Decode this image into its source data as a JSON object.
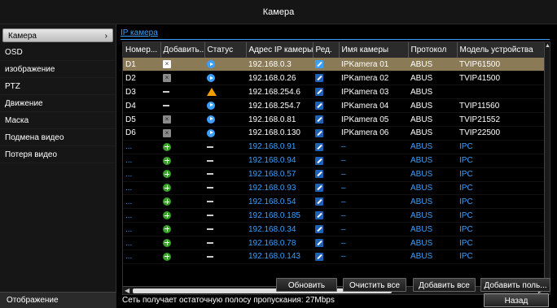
{
  "window": {
    "title": "Камера"
  },
  "sidebar": {
    "items": [
      {
        "label": "Камера",
        "active": true
      },
      {
        "label": "OSD"
      },
      {
        "label": "изображение"
      },
      {
        "label": "PTZ"
      },
      {
        "label": "Движение"
      },
      {
        "label": "Маска"
      },
      {
        "label": "Подмена видео"
      },
      {
        "label": "Потеря видео"
      }
    ],
    "bottom_label": "Отображение"
  },
  "tabs": [
    {
      "label": "IP камера",
      "active": true
    }
  ],
  "table": {
    "columns": [
      "Номер...",
      "Добавить...",
      "Статус",
      "Адрес IP камеры",
      "Ред.",
      "Имя камеры",
      "Протокол",
      "Модель устройства"
    ],
    "rows": [
      {
        "num": "D1",
        "add": "delete-icon",
        "status": "play-icon",
        "ip": "192.168.0.3",
        "edit": "edit-icon",
        "name": "IPKamera 01",
        "protocol": "ABUS",
        "model": "TVIP61500",
        "selected": true
      },
      {
        "num": "D2",
        "add": "delete-icon",
        "status": "play-icon",
        "ip": "192.168.0.26",
        "edit": "edit-icon",
        "name": "IPKamera 02",
        "protocol": "ABUS",
        "model": "TVIP41500"
      },
      {
        "num": "D3",
        "add": "dash",
        "status": "warning-icon",
        "ip": "192.168.254.6",
        "edit": "edit-icon",
        "name": "IPKamera 03",
        "protocol": "ABUS",
        "model": ""
      },
      {
        "num": "D4",
        "add": "dash",
        "status": "play-icon",
        "ip": "192.168.254.7",
        "edit": "edit-icon",
        "name": "IPKamera 04",
        "protocol": "ABUS",
        "model": "TVIP11560"
      },
      {
        "num": "D5",
        "add": "delete-icon",
        "status": "play-icon",
        "ip": "192.168.0.81",
        "edit": "edit-icon",
        "name": "IPKamera 05",
        "protocol": "ABUS",
        "model": "TVIP21552"
      },
      {
        "num": "D6",
        "add": "delete-icon",
        "status": "play-icon",
        "ip": "192.168.0.130",
        "edit": "edit-icon",
        "name": "IPKamera 06",
        "protocol": "ABUS",
        "model": "TVIP22500"
      },
      {
        "num": "...",
        "add": "add-icon",
        "status": "dash",
        "ip": "192.168.0.91",
        "edit": "edit-icon",
        "name": "–",
        "protocol": "ABUS",
        "model": "IPC",
        "found": true
      },
      {
        "num": "...",
        "add": "add-icon",
        "status": "dash",
        "ip": "192.168.0.94",
        "edit": "edit-icon",
        "name": "–",
        "protocol": "ABUS",
        "model": "IPC",
        "found": true
      },
      {
        "num": "...",
        "add": "add-icon",
        "status": "dash",
        "ip": "192.168.0.57",
        "edit": "edit-icon",
        "name": "–",
        "protocol": "ABUS",
        "model": "IPC",
        "found": true
      },
      {
        "num": "...",
        "add": "add-icon",
        "status": "dash",
        "ip": "192.168.0.93",
        "edit": "edit-icon",
        "name": "–",
        "protocol": "ABUS",
        "model": "IPC",
        "found": true
      },
      {
        "num": "...",
        "add": "add-icon",
        "status": "dash",
        "ip": "192.168.0.54",
        "edit": "edit-icon",
        "name": "–",
        "protocol": "ABUS",
        "model": "IPC",
        "found": true
      },
      {
        "num": "...",
        "add": "add-icon",
        "status": "dash",
        "ip": "192.168.0.185",
        "edit": "edit-icon",
        "name": "–",
        "protocol": "ABUS",
        "model": "IPC",
        "found": true
      },
      {
        "num": "...",
        "add": "add-icon",
        "status": "dash",
        "ip": "192.168.0.34",
        "edit": "edit-icon",
        "name": "–",
        "protocol": "ABUS",
        "model": "IPC",
        "found": true
      },
      {
        "num": "...",
        "add": "add-icon",
        "status": "dash",
        "ip": "192.168.0.78",
        "edit": "edit-icon",
        "name": "–",
        "protocol": "ABUS",
        "model": "IPC",
        "found": true
      },
      {
        "num": "...",
        "add": "add-icon",
        "status": "dash",
        "ip": "192.168.0.143",
        "edit": "edit-icon",
        "name": "–",
        "protocol": "ABUS",
        "model": "IPC",
        "found": true
      }
    ]
  },
  "buttons": {
    "refresh": "Обновить",
    "clear_all": "Очистить все",
    "add_all": "Добавить все",
    "add_user": "Добавить поль...",
    "back": "Назад"
  },
  "status_text": "Сеть получает остаточную полосу пропускания: 27Mbps",
  "colors": {
    "accent": "#3aa0ff",
    "selected_row": "#8a7a56",
    "warning": "#f5a000",
    "add": "#3aa12a"
  }
}
